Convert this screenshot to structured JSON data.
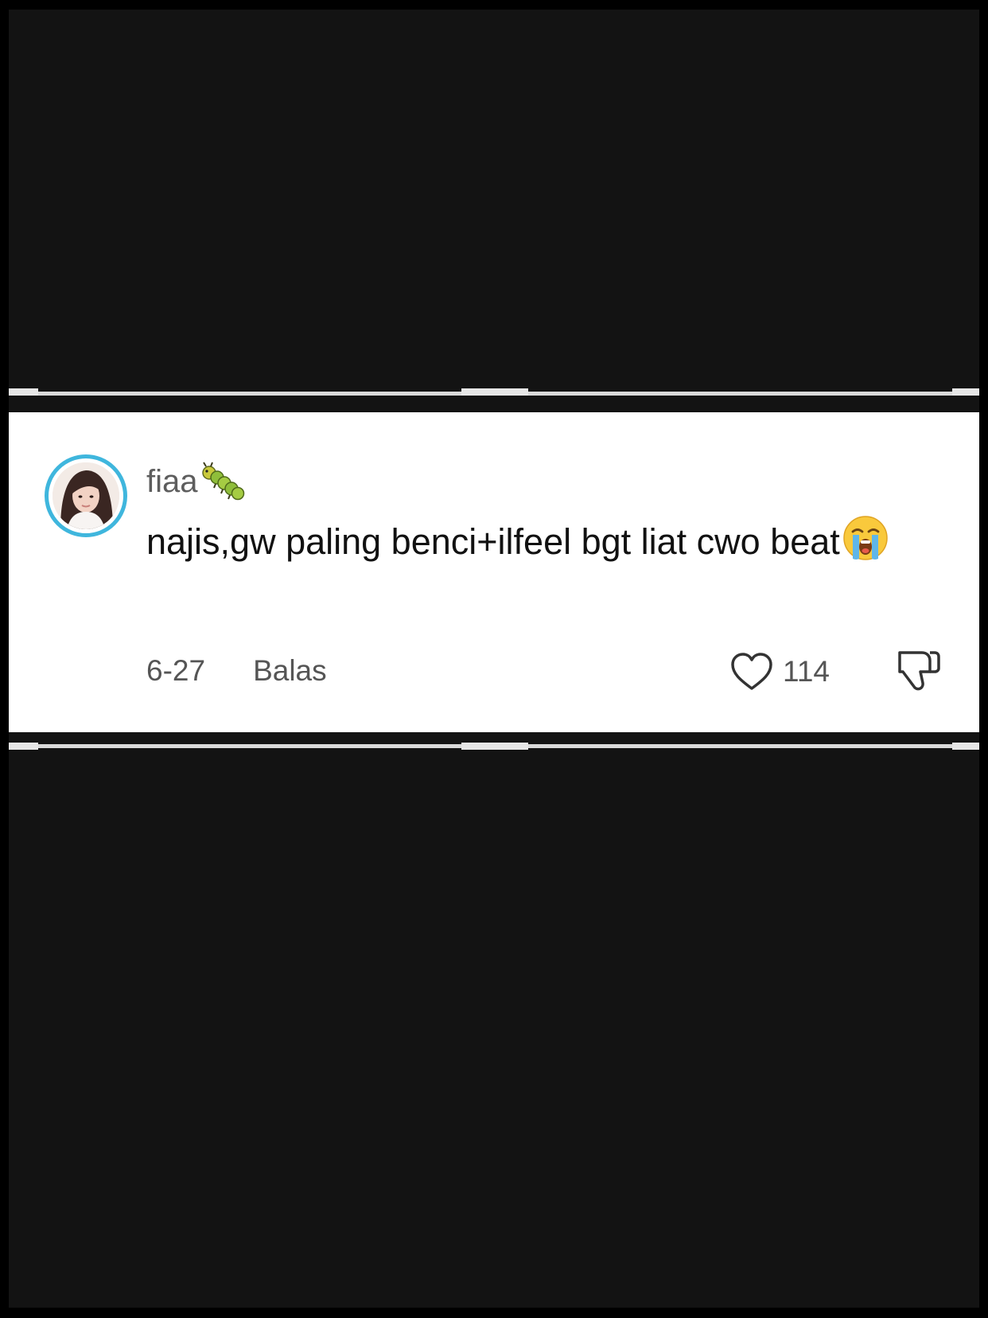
{
  "comment": {
    "username": "fiaa",
    "username_emoji": "caterpillar-emoji",
    "text": "najis,gw paling benci+ilfeel bgt liat cwo beat",
    "text_emoji": "loudly-crying-face-emoji",
    "date": "6-27",
    "reply_label": "Balas",
    "like_count": "114"
  },
  "colors": {
    "avatar_ring": "#3fb6dd",
    "background": "#131313",
    "card": "#ffffff"
  }
}
